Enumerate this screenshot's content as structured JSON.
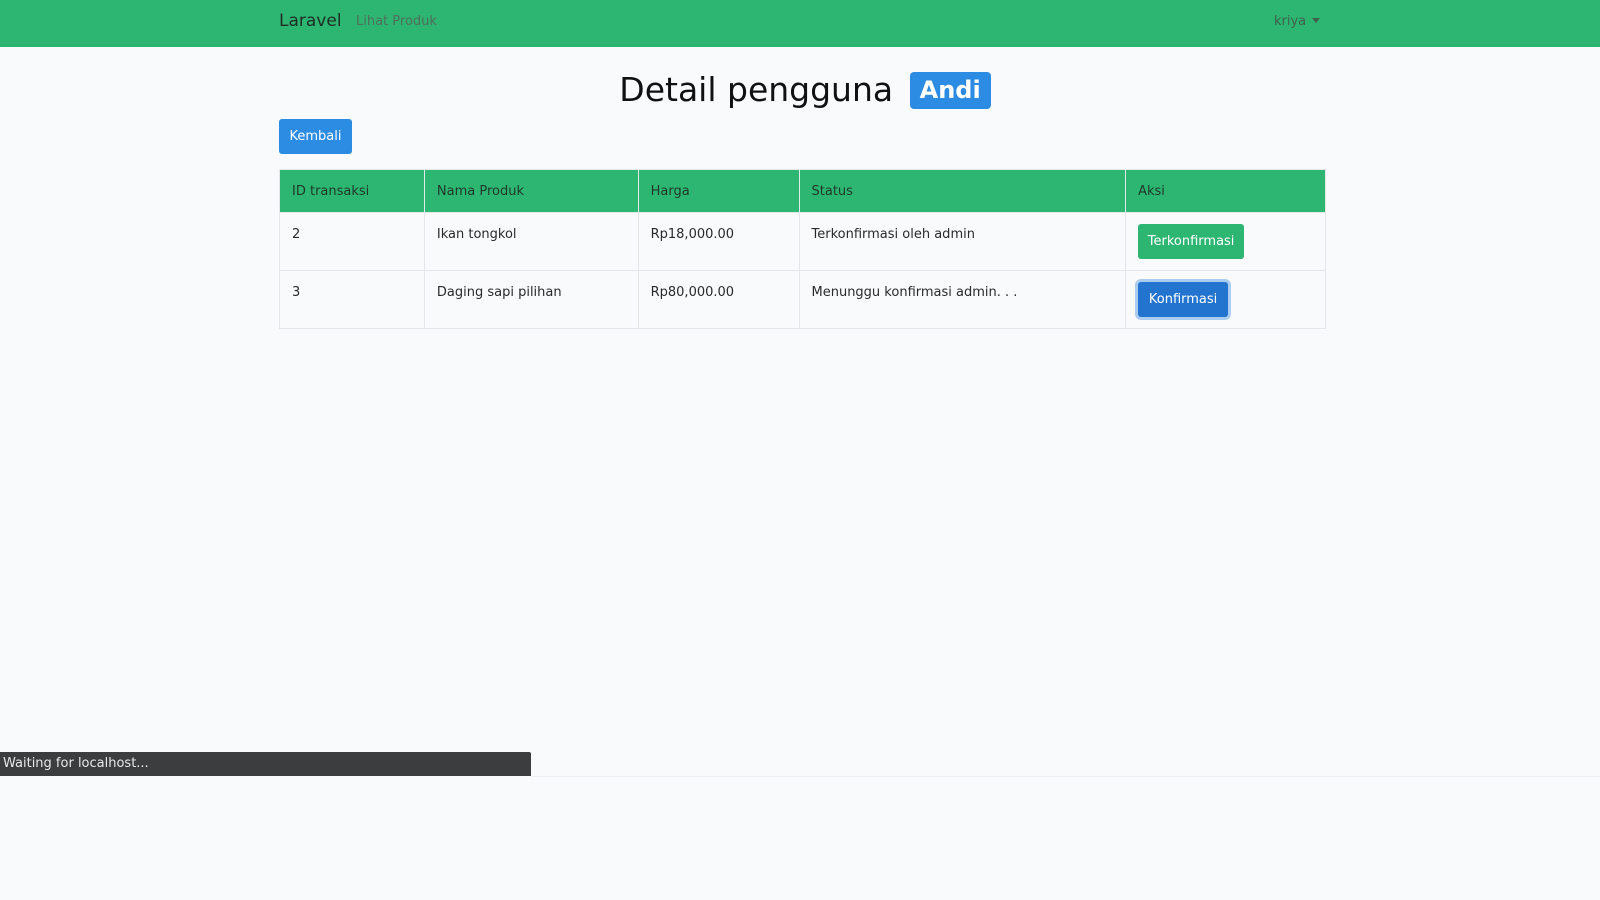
{
  "navbar": {
    "brand": "Laravel",
    "nav_link": "Lihat Produk",
    "user_menu": "kriya",
    "color": "#2db672"
  },
  "page": {
    "title": "Detail pengguna",
    "user_name": "Andi",
    "back_label": "Kembali"
  },
  "table": {
    "headers": [
      "ID transaksi",
      "Nama Produk",
      "Harga",
      "Status",
      "Aksi"
    ],
    "rows": [
      {
        "id": "2",
        "product": "Ikan tongkol",
        "price": "Rp18,000.00",
        "status": "Terkonfirmasi oleh admin",
        "action": "Terkonfirmasi"
      },
      {
        "id": "3",
        "product": "Daging sapi pilihan",
        "price": "Rp80,000.00",
        "status": "Menunggu konfirmasi admin. . .",
        "action": "Konfirmasi"
      }
    ]
  },
  "browser_status": "Waiting for localhost...",
  "colors": {
    "primary": "#2c8be3",
    "success": "#2db672",
    "confirm_button": "#2374cf",
    "status_bar": "#3b3d3f"
  },
  "icons": {
    "user_menu_caret": "caret-down-icon"
  }
}
